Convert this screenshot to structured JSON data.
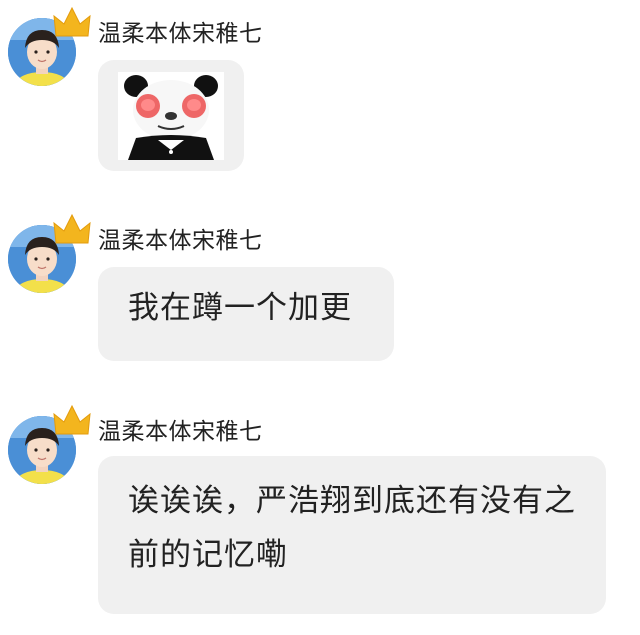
{
  "colors": {
    "bubble_bg": "#f0f0f0",
    "text": "#222222",
    "crown": "#f3b51e",
    "avatar_bg": "#4a8fd6"
  },
  "messages": [
    {
      "sender": "温柔本体宋稚七",
      "type": "sticker",
      "sticker": "panda-meme-sticker"
    },
    {
      "sender": "温柔本体宋稚七",
      "type": "text",
      "text": "我在蹲一个加更"
    },
    {
      "sender": "温柔本体宋稚七",
      "type": "text",
      "text": "诶诶诶，严浩翔到底还有没有之前的记忆嘞"
    }
  ]
}
